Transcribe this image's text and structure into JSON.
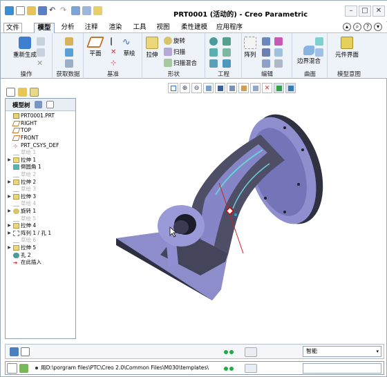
{
  "window": {
    "title": "PRT0001 (活动的) - Creo Parametric"
  },
  "tabs": [
    {
      "label": "文件",
      "active": false
    },
    {
      "label": "模型",
      "active": true
    },
    {
      "label": "分析",
      "active": false
    },
    {
      "label": "注释",
      "active": false
    },
    {
      "label": "渲染",
      "active": false
    },
    {
      "label": "工具",
      "active": false
    },
    {
      "label": "视图",
      "active": false
    },
    {
      "label": "柔性建模",
      "active": false
    },
    {
      "label": "应用程序",
      "active": false
    }
  ],
  "ribbon": {
    "operations": {
      "label": "操作",
      "regen": "重新生成"
    },
    "getdata": {
      "label": "获取数据"
    },
    "datum": {
      "label": "基准",
      "plane": "平面",
      "sketch": "草绘"
    },
    "shapes": {
      "label": "形状",
      "extrude": "拉伸",
      "revolve": "旋转",
      "sweep": "扫描",
      "blend": "扫描混合"
    },
    "engineering": {
      "label": "工程"
    },
    "editing": {
      "label": "编辑",
      "pattern": "阵列"
    },
    "surfaces": {
      "label": "曲面",
      "boundary": "边界混合"
    },
    "intent": {
      "label": "模型意图",
      "component": "元件界面"
    }
  },
  "tree": {
    "header": "模型树",
    "items": [
      {
        "label": "PRT0001.PRT",
        "dim": false,
        "expand": "",
        "icon": "part"
      },
      {
        "label": "RIGHT",
        "dim": false,
        "expand": "",
        "icon": "plane"
      },
      {
        "label": "TOP",
        "dim": false,
        "expand": "",
        "icon": "plane"
      },
      {
        "label": "FRONT",
        "dim": false,
        "expand": "",
        "icon": "plane"
      },
      {
        "label": "PRT_CSYS_DEF",
        "dim": false,
        "expand": "",
        "icon": "csys"
      },
      {
        "label": "草绘 1",
        "dim": true,
        "expand": "",
        "icon": "sketch"
      },
      {
        "label": "拉伸 1",
        "dim": false,
        "expand": "▶",
        "icon": "extrude"
      },
      {
        "label": "倒圆角 1",
        "dim": false,
        "expand": "",
        "icon": "round"
      },
      {
        "label": "草绘 2",
        "dim": true,
        "expand": "",
        "icon": "sketch"
      },
      {
        "label": "拉伸 2",
        "dim": false,
        "expand": "▶",
        "icon": "extrude"
      },
      {
        "label": "草绘 3",
        "dim": true,
        "expand": "",
        "icon": "sketch"
      },
      {
        "label": "拉伸 3",
        "dim": false,
        "expand": "▶",
        "icon": "extrude"
      },
      {
        "label": "草绘 4",
        "dim": true,
        "expand": "",
        "icon": "sketch"
      },
      {
        "label": "旋转 1",
        "dim": false,
        "expand": "▶",
        "icon": "revolve"
      },
      {
        "label": "草绘 5",
        "dim": true,
        "expand": "",
        "icon": "sketch"
      },
      {
        "label": "拉伸 4",
        "dim": false,
        "expand": "▶",
        "icon": "extrude"
      },
      {
        "label": "阵列 1 / 孔 1",
        "dim": false,
        "expand": "▶",
        "icon": "pattern"
      },
      {
        "label": "草绘 6",
        "dim": true,
        "expand": "",
        "icon": "sketch"
      },
      {
        "label": "拉伸 5",
        "dim": false,
        "expand": "▶",
        "icon": "extrude"
      },
      {
        "label": "孔 2",
        "dim": false,
        "expand": "",
        "icon": "hole"
      },
      {
        "label": "在此插入",
        "dim": false,
        "expand": "",
        "icon": "insert"
      }
    ]
  },
  "status": {
    "filter": "智能"
  },
  "cmdline": {
    "message": "用D:\\porgram files\\PTC\\Creo 2.0\\Common Files\\M030\\templates\\"
  },
  "colors": {
    "ribbon_bg": "#eef3f9",
    "model": "#8585c7",
    "model_dark": "#33344a",
    "accent": "#22aa44"
  }
}
